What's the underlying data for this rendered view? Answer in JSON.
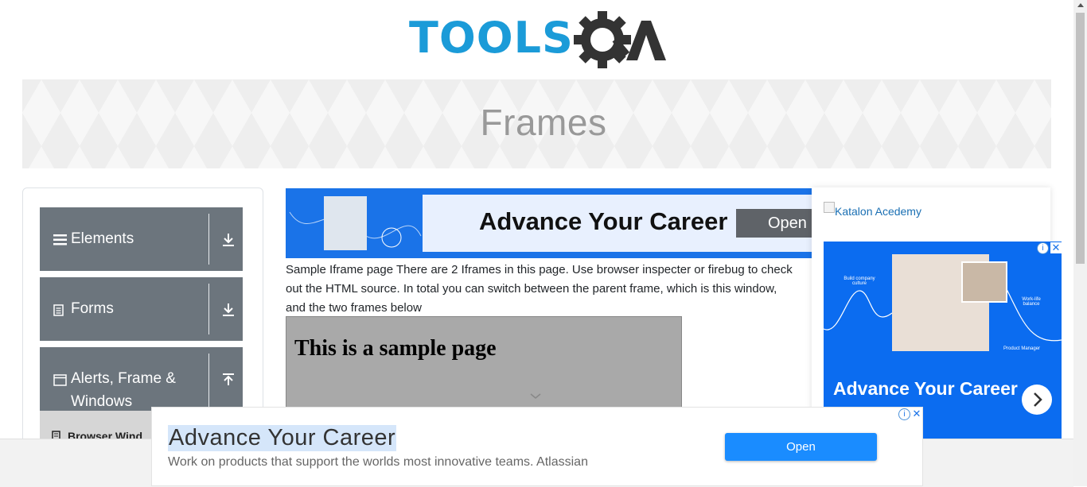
{
  "header": {
    "logo_text_blue": "TOOLS",
    "logo_text_dark": "QA"
  },
  "banner": {
    "title": "Frames"
  },
  "sidebar": {
    "groups": [
      {
        "label": "Elements",
        "icon": "hamburger-icon",
        "arrow": "download-arrow-icon"
      },
      {
        "label": "Forms",
        "icon": "document-icon",
        "arrow": "download-arrow-icon"
      },
      {
        "label": "Alerts, Frame & Windows",
        "icon": "window-icon",
        "arrow": "upload-arrow-icon"
      }
    ],
    "subitem": {
      "label": "Browser Wind",
      "icon": "book-icon"
    }
  },
  "mid_ad": {
    "title": "Advance Your Career",
    "button": "Open"
  },
  "content": {
    "description": "Sample Iframe page There are 2 Iframes in this page. Use browser inspecter or firebug to check out the HTML source. In total you can switch between the parent frame, which is this window, and the two frames below",
    "frame_heading": "This is a sample page"
  },
  "right_ad": {
    "image_alt": "Katalon Acedemy",
    "title": "Advance Your Career",
    "small_texts": [
      "Build company culture",
      "Work-life balance",
      "Product Manager"
    ]
  },
  "bottom_ad": {
    "title": "Advance Your Career",
    "description": "Work on products that support the worlds most innovative teams. Atlassian",
    "button": "Open"
  },
  "colors": {
    "logo_blue": "#1b9bd8",
    "logo_dark": "#333333",
    "sidebar_header": "#6c757d",
    "ad_blue": "#1a73e8",
    "open_button": "#1a8cff"
  }
}
